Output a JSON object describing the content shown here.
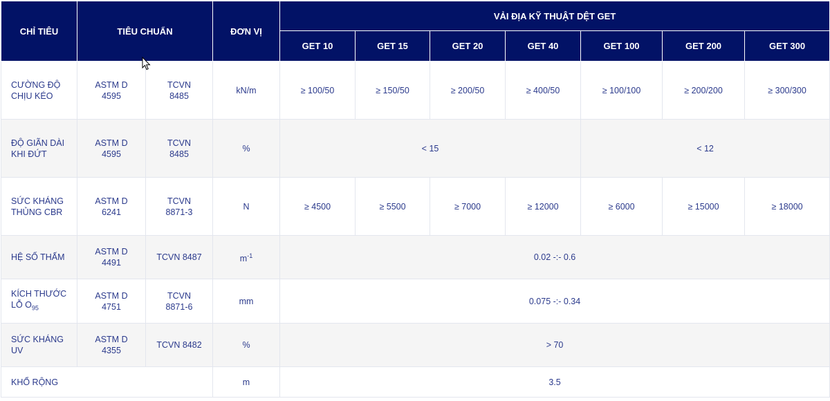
{
  "header": {
    "chi_tieu": "CHỈ TIÊU",
    "tieu_chuan": "TIÊU CHUẨN",
    "don_vi": "ĐƠN VỊ",
    "group": "VẢI ĐỊA KỸ THUẬT DỆT GET",
    "products": [
      "GET 10",
      "GET 15",
      "GET 20",
      "GET 40",
      "GET 100",
      "GET 200",
      "GET 300"
    ]
  },
  "rows": [
    {
      "label_line1": "CƯỜNG ĐỘ",
      "label_line2": "CHỊU KÉO",
      "astm_line1": "ASTM D",
      "astm_line2": "4595",
      "tcvn_line1": "TCVN",
      "tcvn_line2": "8485",
      "unit": "kN/m",
      "values": [
        "≥ 100/50",
        "≥ 150/50",
        "≥ 200/50",
        "≥ 400/50",
        "≥ 100/100",
        "≥ 200/200",
        "≥ 300/300"
      ]
    },
    {
      "label_line1": "ĐỘ GIÃN DÀI",
      "label_line2": "KHI ĐỨT",
      "astm_line1": "ASTM D",
      "astm_line2": "4595",
      "tcvn_line1": "TCVN",
      "tcvn_line2": "8485",
      "unit": "%",
      "value_a": "< 15",
      "value_b": "< 12"
    },
    {
      "label_line1": "SỨC KHÁNG",
      "label_line2": "THỦNG CBR",
      "astm_line1": "ASTM D",
      "astm_line2": "6241",
      "tcvn_line1": "TCVN",
      "tcvn_line2": "8871-3",
      "unit": "N",
      "values": [
        "≥ 4500",
        "≥ 5500",
        "≥ 7000",
        "≥ 12000",
        "≥ 6000",
        "≥ 15000",
        "≥ 18000"
      ]
    },
    {
      "label": "HỆ SỐ THẤM",
      "astm_line1": "ASTM D",
      "astm_line2": "4491",
      "tcvn": "TCVN 8487",
      "unit_base": "m",
      "unit_sup": "-1",
      "value": "0.02 -:- 0.6"
    },
    {
      "label_line1": "KÍCH THƯỚC",
      "label_line2_base": "LỖ O",
      "label_line2_sub": "95",
      "astm_line1": "ASTM D",
      "astm_line2": "4751",
      "tcvn_line1": "TCVN",
      "tcvn_line2": "8871-6",
      "unit": "mm",
      "value": "0.075 -:- 0.34"
    },
    {
      "label_line1": "SỨC KHÁNG",
      "label_line2": "UV",
      "astm_line1": "ASTM D",
      "astm_line2": "4355",
      "tcvn": "TCVN 8482",
      "unit": "%",
      "value": "> 70"
    },
    {
      "label": "KHỔ RỘNG",
      "unit": "m",
      "value": "3.5"
    }
  ],
  "colors": {
    "header_bg": "#021266",
    "header_text": "#ffffff",
    "body_text": "#2b3a8c",
    "row_shade": "#f5f5f5"
  }
}
